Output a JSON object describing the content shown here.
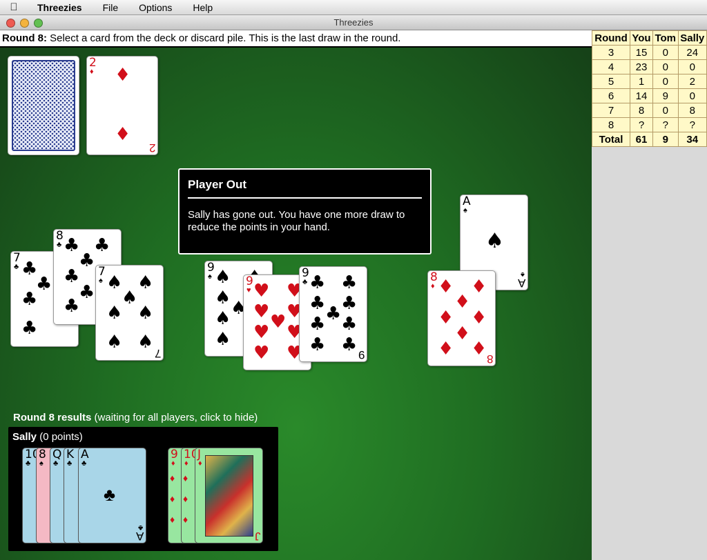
{
  "menubar": {
    "app_name": "Threezies",
    "menus": [
      "File",
      "Options",
      "Help"
    ]
  },
  "window": {
    "title": "Threezies"
  },
  "status": {
    "prefix": "Round 8:",
    "message": "Select a card from the deck or discard pile. This is the last draw in the round."
  },
  "dialog": {
    "title": "Player Out",
    "text": "Sally has gone out. You have one more draw to reduce the points in your hand."
  },
  "discard": {
    "rank": "2",
    "suit": "♦"
  },
  "tom_cards": [
    {
      "rank": "7",
      "suit": "♣"
    },
    {
      "rank": "8",
      "suit": "♣"
    },
    {
      "rank": "7",
      "suit": "♠"
    }
  ],
  "middle_cards": [
    {
      "rank": "9",
      "suit": "♠"
    },
    {
      "rank": "9",
      "suit": "♥"
    },
    {
      "rank": "9",
      "suit": "♣"
    }
  ],
  "right_cards": [
    {
      "rank": "A",
      "suit": "♠"
    },
    {
      "rank": "8",
      "suit": "♦"
    }
  ],
  "results": {
    "heading_bold": "Round 8 results",
    "heading_rest": "(waiting for all players, click to hide)",
    "player": "Sally",
    "points": "(0 points)",
    "group1": [
      {
        "rank": "10",
        "suit": "♣"
      },
      {
        "rank": "8",
        "suit": "♠"
      },
      {
        "rank": "Q",
        "suit": "♣"
      },
      {
        "rank": "K",
        "suit": "♣"
      },
      {
        "rank": "A",
        "suit": "♣"
      }
    ],
    "group2": [
      {
        "rank": "9",
        "suit": "♦"
      },
      {
        "rank": "10",
        "suit": "♦"
      },
      {
        "rank": "J",
        "suit": "♦"
      }
    ]
  },
  "scoreboard": {
    "headers": [
      "Round",
      "You",
      "Tom",
      "Sally"
    ],
    "rows": [
      [
        "3",
        "15",
        "0",
        "24"
      ],
      [
        "4",
        "23",
        "0",
        "0"
      ],
      [
        "5",
        "1",
        "0",
        "2"
      ],
      [
        "6",
        "14",
        "9",
        "0"
      ],
      [
        "7",
        "8",
        "0",
        "8"
      ],
      [
        "8",
        "?",
        "?",
        "?"
      ]
    ],
    "total": [
      "Total",
      "61",
      "9",
      "34"
    ]
  },
  "colors": {
    "felt": "#1f6d22",
    "score_bg": "#fff9c8",
    "red_suit": "#d10f1a"
  }
}
